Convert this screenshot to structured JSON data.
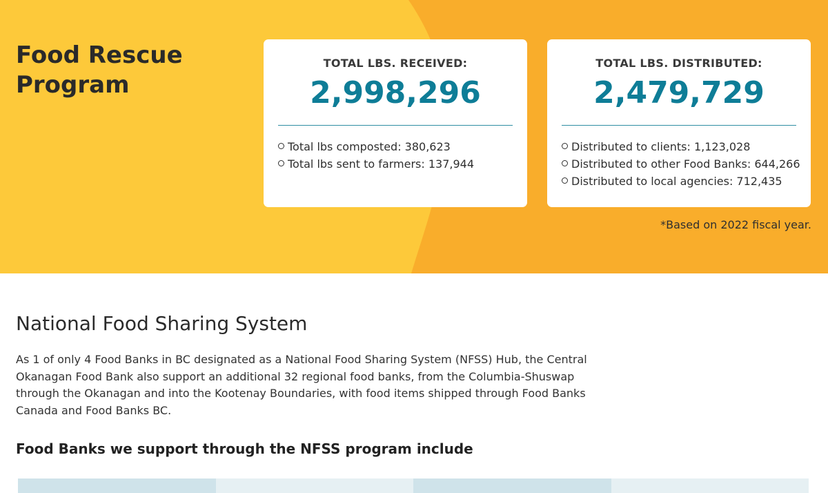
{
  "hero": {
    "title": "Food Rescue Program",
    "colors": {
      "yellow": "#fdc93a",
      "orange": "#f9ad2b",
      "accent": "#0e7d97"
    },
    "cards": [
      {
        "heading": "TOTAL LBS. RECEIVED:",
        "value": "2,998,296",
        "items": [
          "Total lbs composted: 380,623",
          "Total lbs sent to farmers: 137,944"
        ]
      },
      {
        "heading": "TOTAL LBS. DISTRIBUTED:",
        "value": "2,479,729",
        "items": [
          "Distributed to clients: 1,123,028",
          "Distributed to other Food Banks: 644,266",
          "Distributed to local agencies: 712,435"
        ]
      }
    ],
    "footnote": "*Based on 2022 fiscal year."
  },
  "nfss": {
    "title": "National Food Sharing System",
    "body": "As 1 of only 4 Food Banks in BC designated as a National Food Sharing System (NFSS) Hub, the Central Okanagan Food Bank also support an additional 32 regional food banks, from the Columbia-Shuswap through the Okanagan and into the Kootenay Boundaries, with food items shipped through Food Banks Canada and Food Banks BC.",
    "subheading": "Food Banks we support through the NFSS program include"
  }
}
